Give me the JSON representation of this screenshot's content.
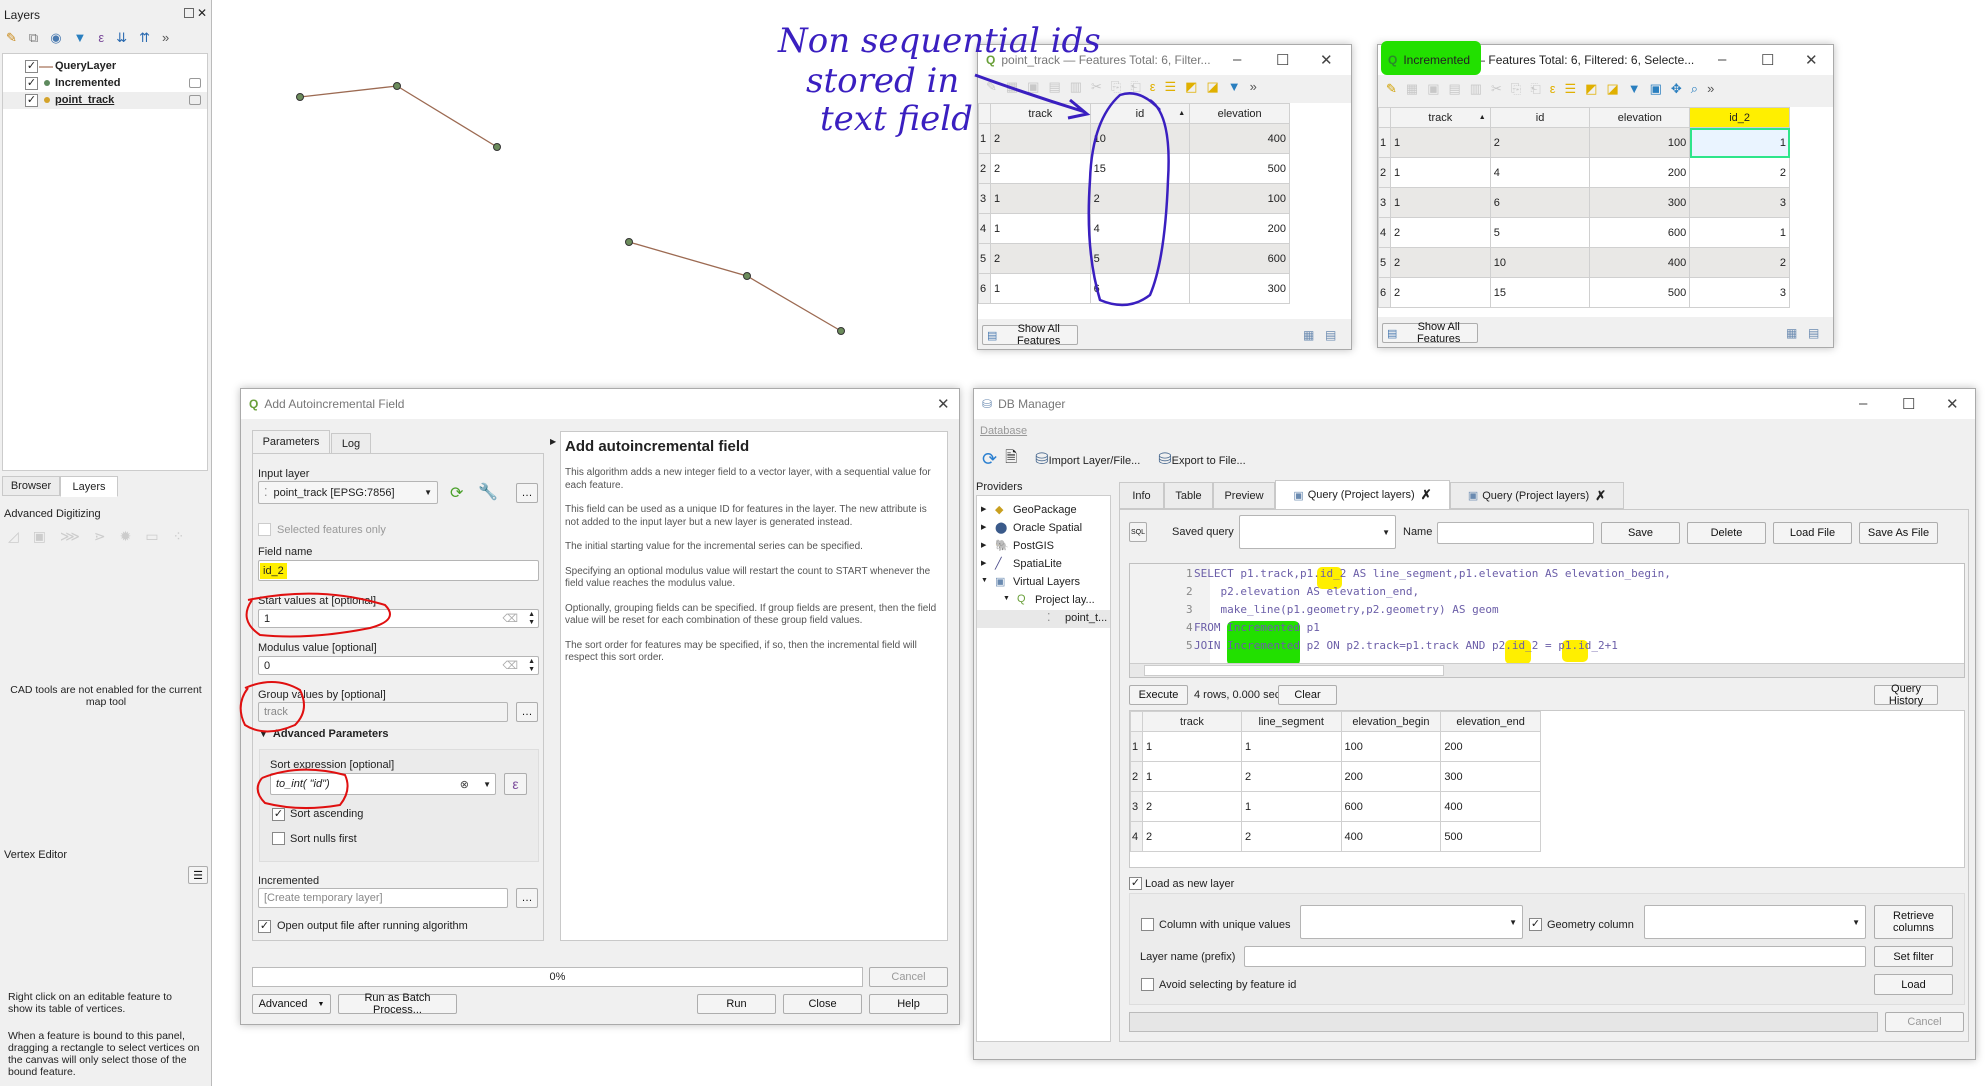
{
  "layers_panel": {
    "title": "Layers",
    "items": [
      {
        "name": "QueryLayer",
        "checked": true,
        "symbol": "line",
        "color": "#c8a898"
      },
      {
        "name": "Incremented",
        "checked": true,
        "symbol": "point",
        "color": "#5e8a5e"
      },
      {
        "name": "point_track",
        "checked": true,
        "symbol": "point",
        "color": "#d4a32a"
      }
    ],
    "tabs": [
      "Browser",
      "Layers"
    ],
    "active_tab": "Layers"
  },
  "adv_digitizing": {
    "title": "Advanced Digitizing",
    "message": "CAD tools are not enabled for the current map tool"
  },
  "vertex_editor": {
    "title": "Vertex Editor",
    "message1": "Right click on an editable feature to show its table of vertices.",
    "message2": "When a feature is bound to this panel, dragging a rectangle to select vertices on the canvas will only select those of the bound feature."
  },
  "annotation": {
    "line1": "Non sequential ids",
    "line2": "stored in",
    "line3": "text field",
    "ink_color": "#3a1fc0",
    "highlight_yellow": "#ffef00",
    "highlight_green": "#22e000",
    "circle_red": "#e01010"
  },
  "point_track_window": {
    "title": "point_track — Features Total: 6, Filter...",
    "columns": [
      "track",
      "id",
      "elevation"
    ],
    "sorted_column": "id",
    "rows": [
      [
        "2",
        "10",
        "400"
      ],
      [
        "2",
        "15",
        "500"
      ],
      [
        "1",
        "2",
        "100"
      ],
      [
        "1",
        "4",
        "200"
      ],
      [
        "2",
        "5",
        "600"
      ],
      [
        "1",
        "6",
        "300"
      ]
    ],
    "show_all": "Show All Features"
  },
  "incremented_window": {
    "title_layer": "Incremented",
    "title_rest": "— Features Total: 6, Filtered: 6, Selecte...",
    "columns": [
      "track",
      "id",
      "elevation",
      "id_2"
    ],
    "sorted_column": "track",
    "rows": [
      [
        "1",
        "2",
        "100",
        "1"
      ],
      [
        "1",
        "4",
        "200",
        "2"
      ],
      [
        "1",
        "6",
        "300",
        "3"
      ],
      [
        "2",
        "5",
        "600",
        "1"
      ],
      [
        "2",
        "10",
        "400",
        "2"
      ],
      [
        "2",
        "15",
        "500",
        "3"
      ]
    ],
    "show_all": "Show All Features"
  },
  "autoinc_dialog": {
    "title": "Add Autoincremental Field",
    "tabs": [
      "Parameters",
      "Log"
    ],
    "input_layer_label": "Input layer",
    "input_layer_value": "point_track [EPSG:7856]",
    "selected_only": "Selected features only",
    "field_name_label": "Field name",
    "field_name_value": "id_2",
    "start_label": "Start values at [optional]",
    "start_value": "1",
    "modulus_label": "Modulus value [optional]",
    "modulus_value": "0",
    "group_label": "Group values by [optional]",
    "group_value": "track",
    "advanced_label": "Advanced Parameters",
    "sort_label": "Sort expression [optional]",
    "sort_value": "to_int( \"id\")",
    "sort_ascending": "Sort ascending",
    "sort_nulls": "Sort nulls first",
    "output_label": "Incremented",
    "output_placeholder": "[Create temporary layer]",
    "open_output": "Open output file after running algorithm",
    "help_title": "Add autoincremental field",
    "help_paragraphs": [
      "This algorithm adds a new integer field to a vector layer, with a sequential value for each feature.",
      "This field can be used as a unique ID for features in the layer. The new attribute is not added to the input layer but a new layer is generated instead.",
      "The initial starting value for the incremental series can be specified.",
      "Specifying an optional modulus value will restart the count to START whenever the field value reaches the modulus value.",
      "Optionally, grouping fields can be specified. If group fields are present, then the field value will be reset for each combination of these group field values.",
      "The sort order for features may be specified, if so, then the incremental field will respect this sort order."
    ],
    "progress": "0%",
    "progress_value": 0,
    "cancel": "Cancel",
    "advanced": "Advanced",
    "batch": "Run as Batch Process...",
    "run": "Run",
    "close": "Close",
    "help": "Help"
  },
  "db_manager": {
    "title": "DB Manager",
    "menu": "Database",
    "import": "Import Layer/File...",
    "export": "Export to File...",
    "providers_label": "Providers",
    "providers": [
      "GeoPackage",
      "Oracle Spatial",
      "PostGIS",
      "SpatiaLite",
      "Virtual Layers",
      "Project lay...",
      "point_t..."
    ],
    "tabs": [
      "Info",
      "Table",
      "Preview",
      "Query (Project layers)",
      "Query (Project layers)"
    ],
    "saved_query": "Saved query",
    "name": "Name",
    "save": "Save",
    "delete": "Delete",
    "load_file": "Load File",
    "save_as_file": "Save As File",
    "sql_lines": [
      "SELECT p1.track,p1.id_2 AS line_segment,p1.elevation AS elevation_begin,",
      "    p2.elevation AS elevation_end,",
      "    make_line(p1.geometry,p2.geometry) AS geom",
      "FROM Incremented p1",
      "JOIN Incremented p2 ON p2.track=p1.track AND p2.id_2 = p1.id_2+1"
    ],
    "execute": "Execute",
    "status": "4 rows, 0.000 seconds",
    "clear": "Clear",
    "query_history": "Query History",
    "result_columns": [
      "track",
      "line_segment",
      "elevation_begin",
      "elevation_end"
    ],
    "result_rows": [
      [
        "1",
        "1",
        "100",
        "200"
      ],
      [
        "1",
        "2",
        "200",
        "300"
      ],
      [
        "2",
        "1",
        "600",
        "400"
      ],
      [
        "2",
        "2",
        "400",
        "500"
      ]
    ],
    "load_as_new": "Load as new layer",
    "unique_col": "Column with unique values",
    "geom_col": "Geometry column",
    "retrieve": "Retrieve columns",
    "layer_prefix": "Layer name (prefix)",
    "set_filter": "Set filter",
    "avoid": "Avoid selecting by feature id",
    "load": "Load",
    "cancel": "Cancel"
  }
}
